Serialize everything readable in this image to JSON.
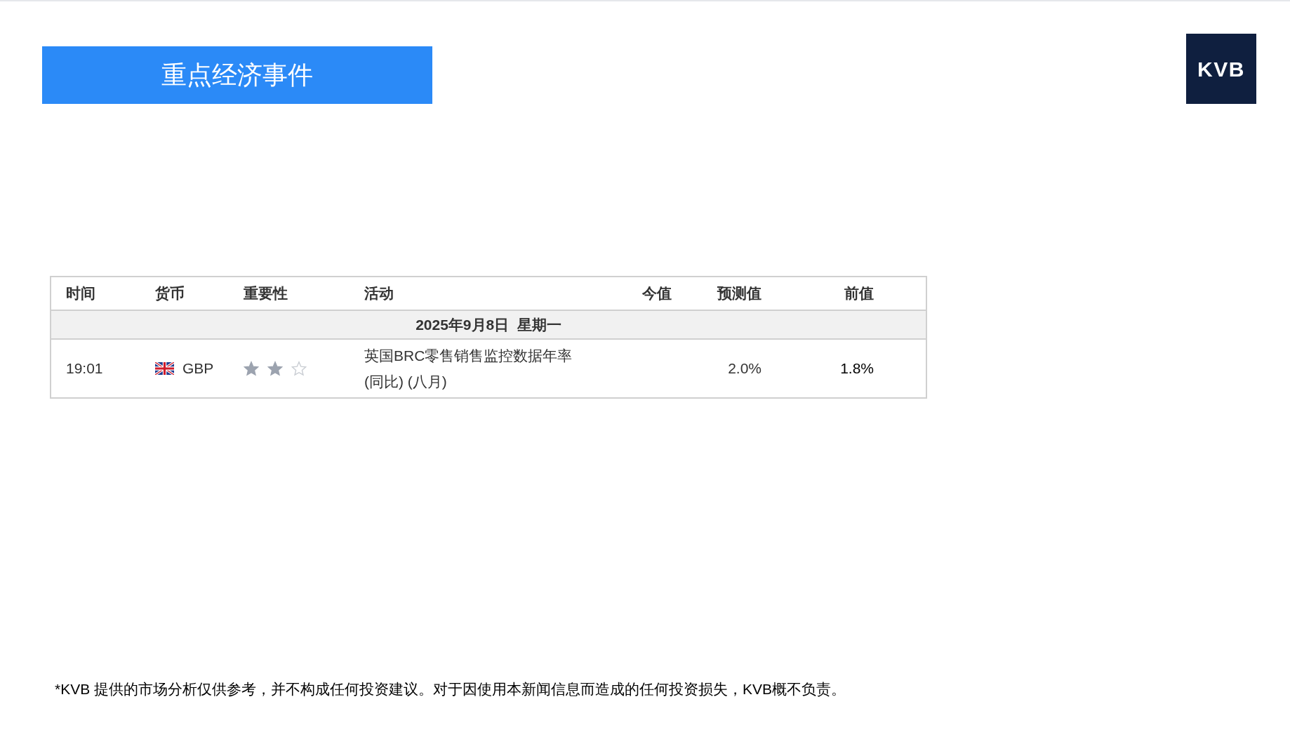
{
  "header": {
    "title": "重点经济事件",
    "logo": "KVB"
  },
  "table": {
    "columns": [
      "时间",
      "货币",
      "重要性",
      "活动",
      "今值",
      "预测值",
      "前值"
    ],
    "date_row": "2025年9月8日  星期一",
    "rows": [
      {
        "time": "19:01",
        "currency": "GBP",
        "stars": 2,
        "event": "英国BRC零售销售监控数据年率",
        "event_detail": "(同比) (八月)",
        "actual": "",
        "forecast": "2.0%",
        "previous": "1.8%"
      }
    ]
  },
  "footer": {
    "disclaimer": "*KVB 提供的市场分析仅供参考，并不构成任何投资建议。对于因使用本新闻信息而造成的任何投资损失，KVB概不负责。"
  }
}
